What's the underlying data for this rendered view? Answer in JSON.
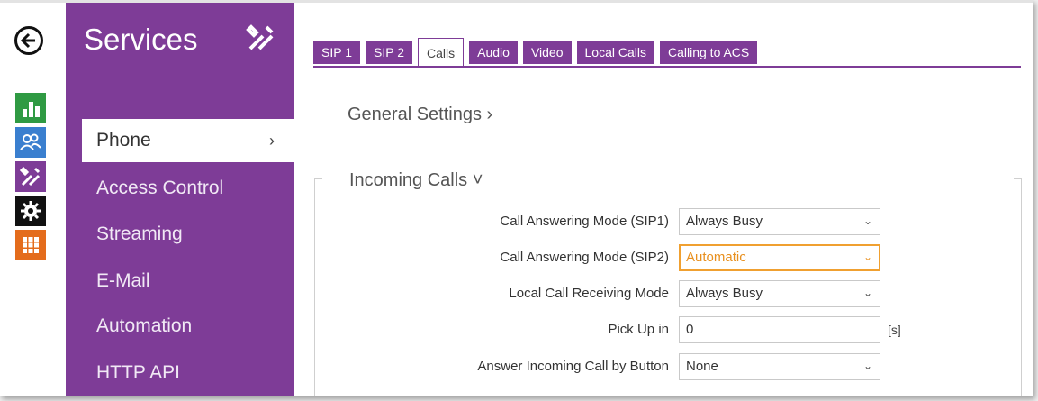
{
  "rail": {
    "icons": [
      "back-arrow-icon",
      "status-chart-icon",
      "users-icon",
      "services-tools-icon",
      "settings-gear-icon",
      "grid-apps-icon"
    ],
    "colors": {
      "chart": "#2f9a43",
      "users": "#3a7fcf",
      "tools": "#7e3c97",
      "gear": "#111111",
      "grid": "#e46c1c"
    }
  },
  "nav": {
    "title": "Services",
    "items": [
      {
        "label": "Phone",
        "chevron": "›"
      },
      {
        "label": "Access Control"
      },
      {
        "label": "Streaming"
      },
      {
        "label": "E-Mail"
      },
      {
        "label": "Automation"
      },
      {
        "label": "HTTP API"
      }
    ]
  },
  "tabs": [
    "SIP 1",
    "SIP 2",
    "Calls",
    "Audio",
    "Video",
    "Local Calls",
    "Calling to ACS"
  ],
  "sections": {
    "general": "General Settings ›",
    "incoming": "Incoming Calls ˅"
  },
  "form": {
    "rows": [
      {
        "label": "Call Answering Mode (SIP1)",
        "value": "Always Busy"
      },
      {
        "label": "Call Answering Mode (SIP2)",
        "value": "Automatic"
      },
      {
        "label": "Local Call Receiving Mode",
        "value": "Always Busy"
      },
      {
        "label": "Pick Up in",
        "value": "0",
        "unit": "[s]"
      },
      {
        "label": "Answer Incoming Call by Button",
        "value": "None"
      }
    ]
  },
  "colors": {
    "accent": "#7e3c97",
    "focus": "#f0a030"
  }
}
